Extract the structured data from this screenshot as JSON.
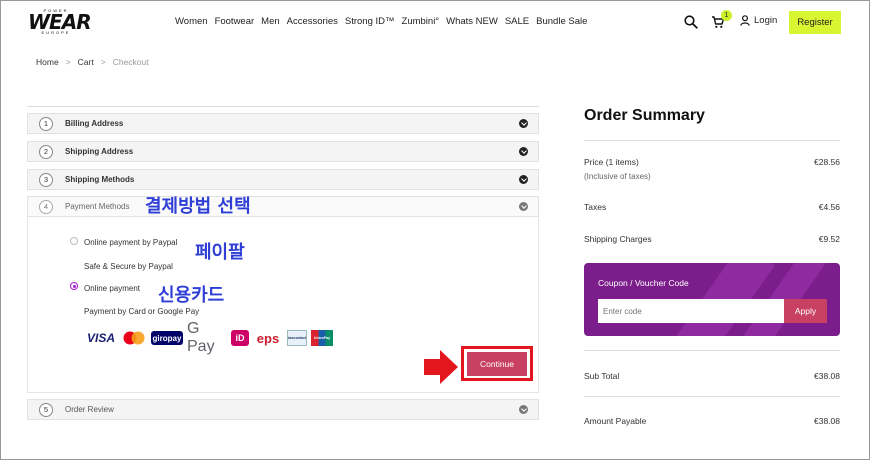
{
  "header": {
    "logo_top": "POWER",
    "logo_main": "WEAR",
    "logo_sub": "EUROPE",
    "nav": [
      "Women",
      "Footwear",
      "Men",
      "Accessories",
      "Strong ID™",
      "Zumbini°",
      "Whats NEW",
      "SALE",
      "Bundle Sale"
    ],
    "cart_count": "1",
    "login_label": "Login",
    "register_label": "Register"
  },
  "breadcrumb": [
    "Home",
    "Cart",
    "Checkout"
  ],
  "checkout": {
    "steps": [
      {
        "num": "1",
        "label": "Billing Address"
      },
      {
        "num": "2",
        "label": "Shipping Address"
      },
      {
        "num": "3",
        "label": "Shipping Methods"
      },
      {
        "num": "4",
        "label": "Payment Methods"
      },
      {
        "num": "5",
        "label": "Order Review"
      }
    ],
    "payment": {
      "paypal_label": "Online payment by Paypal",
      "paypal_desc": "Safe & Secure by Paypal",
      "card_label": "Online payment",
      "card_desc": "Payment by Card  or Google Pay",
      "logos": [
        "VISA",
        "mastercard",
        "giropay",
        "G Pay",
        "iD",
        "eps",
        "bancontact",
        "UnionPay"
      ]
    },
    "continue_label": "Continue"
  },
  "annotations": {
    "select_payment": "결제방법 선택",
    "paypal": "페이팔",
    "credit_card": "신용카드"
  },
  "summary": {
    "title": "Order Summary",
    "price_label": "Price (1 items)",
    "price_sub": "(Inclusive of taxes)",
    "price_value": "€28.56",
    "taxes_label": "Taxes",
    "taxes_value": "€4.56",
    "shipping_label": "Shipping Charges",
    "shipping_value": "€9.52",
    "coupon_title": "Coupon / Voucher Code",
    "coupon_placeholder": "Enter code",
    "apply_label": "Apply",
    "subtotal_label": "Sub Total",
    "subtotal_value": "€38.08",
    "payable_label": "Amount Payable",
    "payable_value": "€38.08"
  },
  "colors": {
    "register_bg": "#d8f532",
    "accent_button": "#c84162",
    "coupon_bg": "#7b1e8c",
    "highlight_red": "#e3151d",
    "annotation_blue": "#2f3fd6"
  }
}
